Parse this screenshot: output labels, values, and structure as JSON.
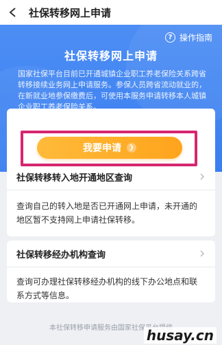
{
  "nav": {
    "title": "社保转移网上申请"
  },
  "banner": {
    "guide_label": "操作指南",
    "headline": "社保转移网上申请",
    "intro": "国家社保平台目前已开通城镇企业职工养老保险关系跨省转移接续业务网上申请服务。参保人员跨省流动就业的，在新就业地参保缴费后，可使用本服务申请转移本人城镇企业职工养老保险关系。"
  },
  "apply": {
    "button_label": "我要申请"
  },
  "sections": [
    {
      "title": "社保转移转入地开通地区查询",
      "desc": "查询自己的转入地是否已开通网上申请，未开通的地区暂不支持网上申请社保转移。"
    },
    {
      "title": "社保转移经办机构查询",
      "desc": "查询可办理社保转移经办机构的线下办公地点和联系方式等信息。"
    }
  ],
  "footer": {
    "text": "本社保转移申请服务由国家社保平台提供"
  },
  "watermark": {
    "text": "husay.cn"
  },
  "colors": {
    "primary": "#3a7ef0",
    "button": "#ffa41c",
    "highlight": "#d6276f"
  }
}
